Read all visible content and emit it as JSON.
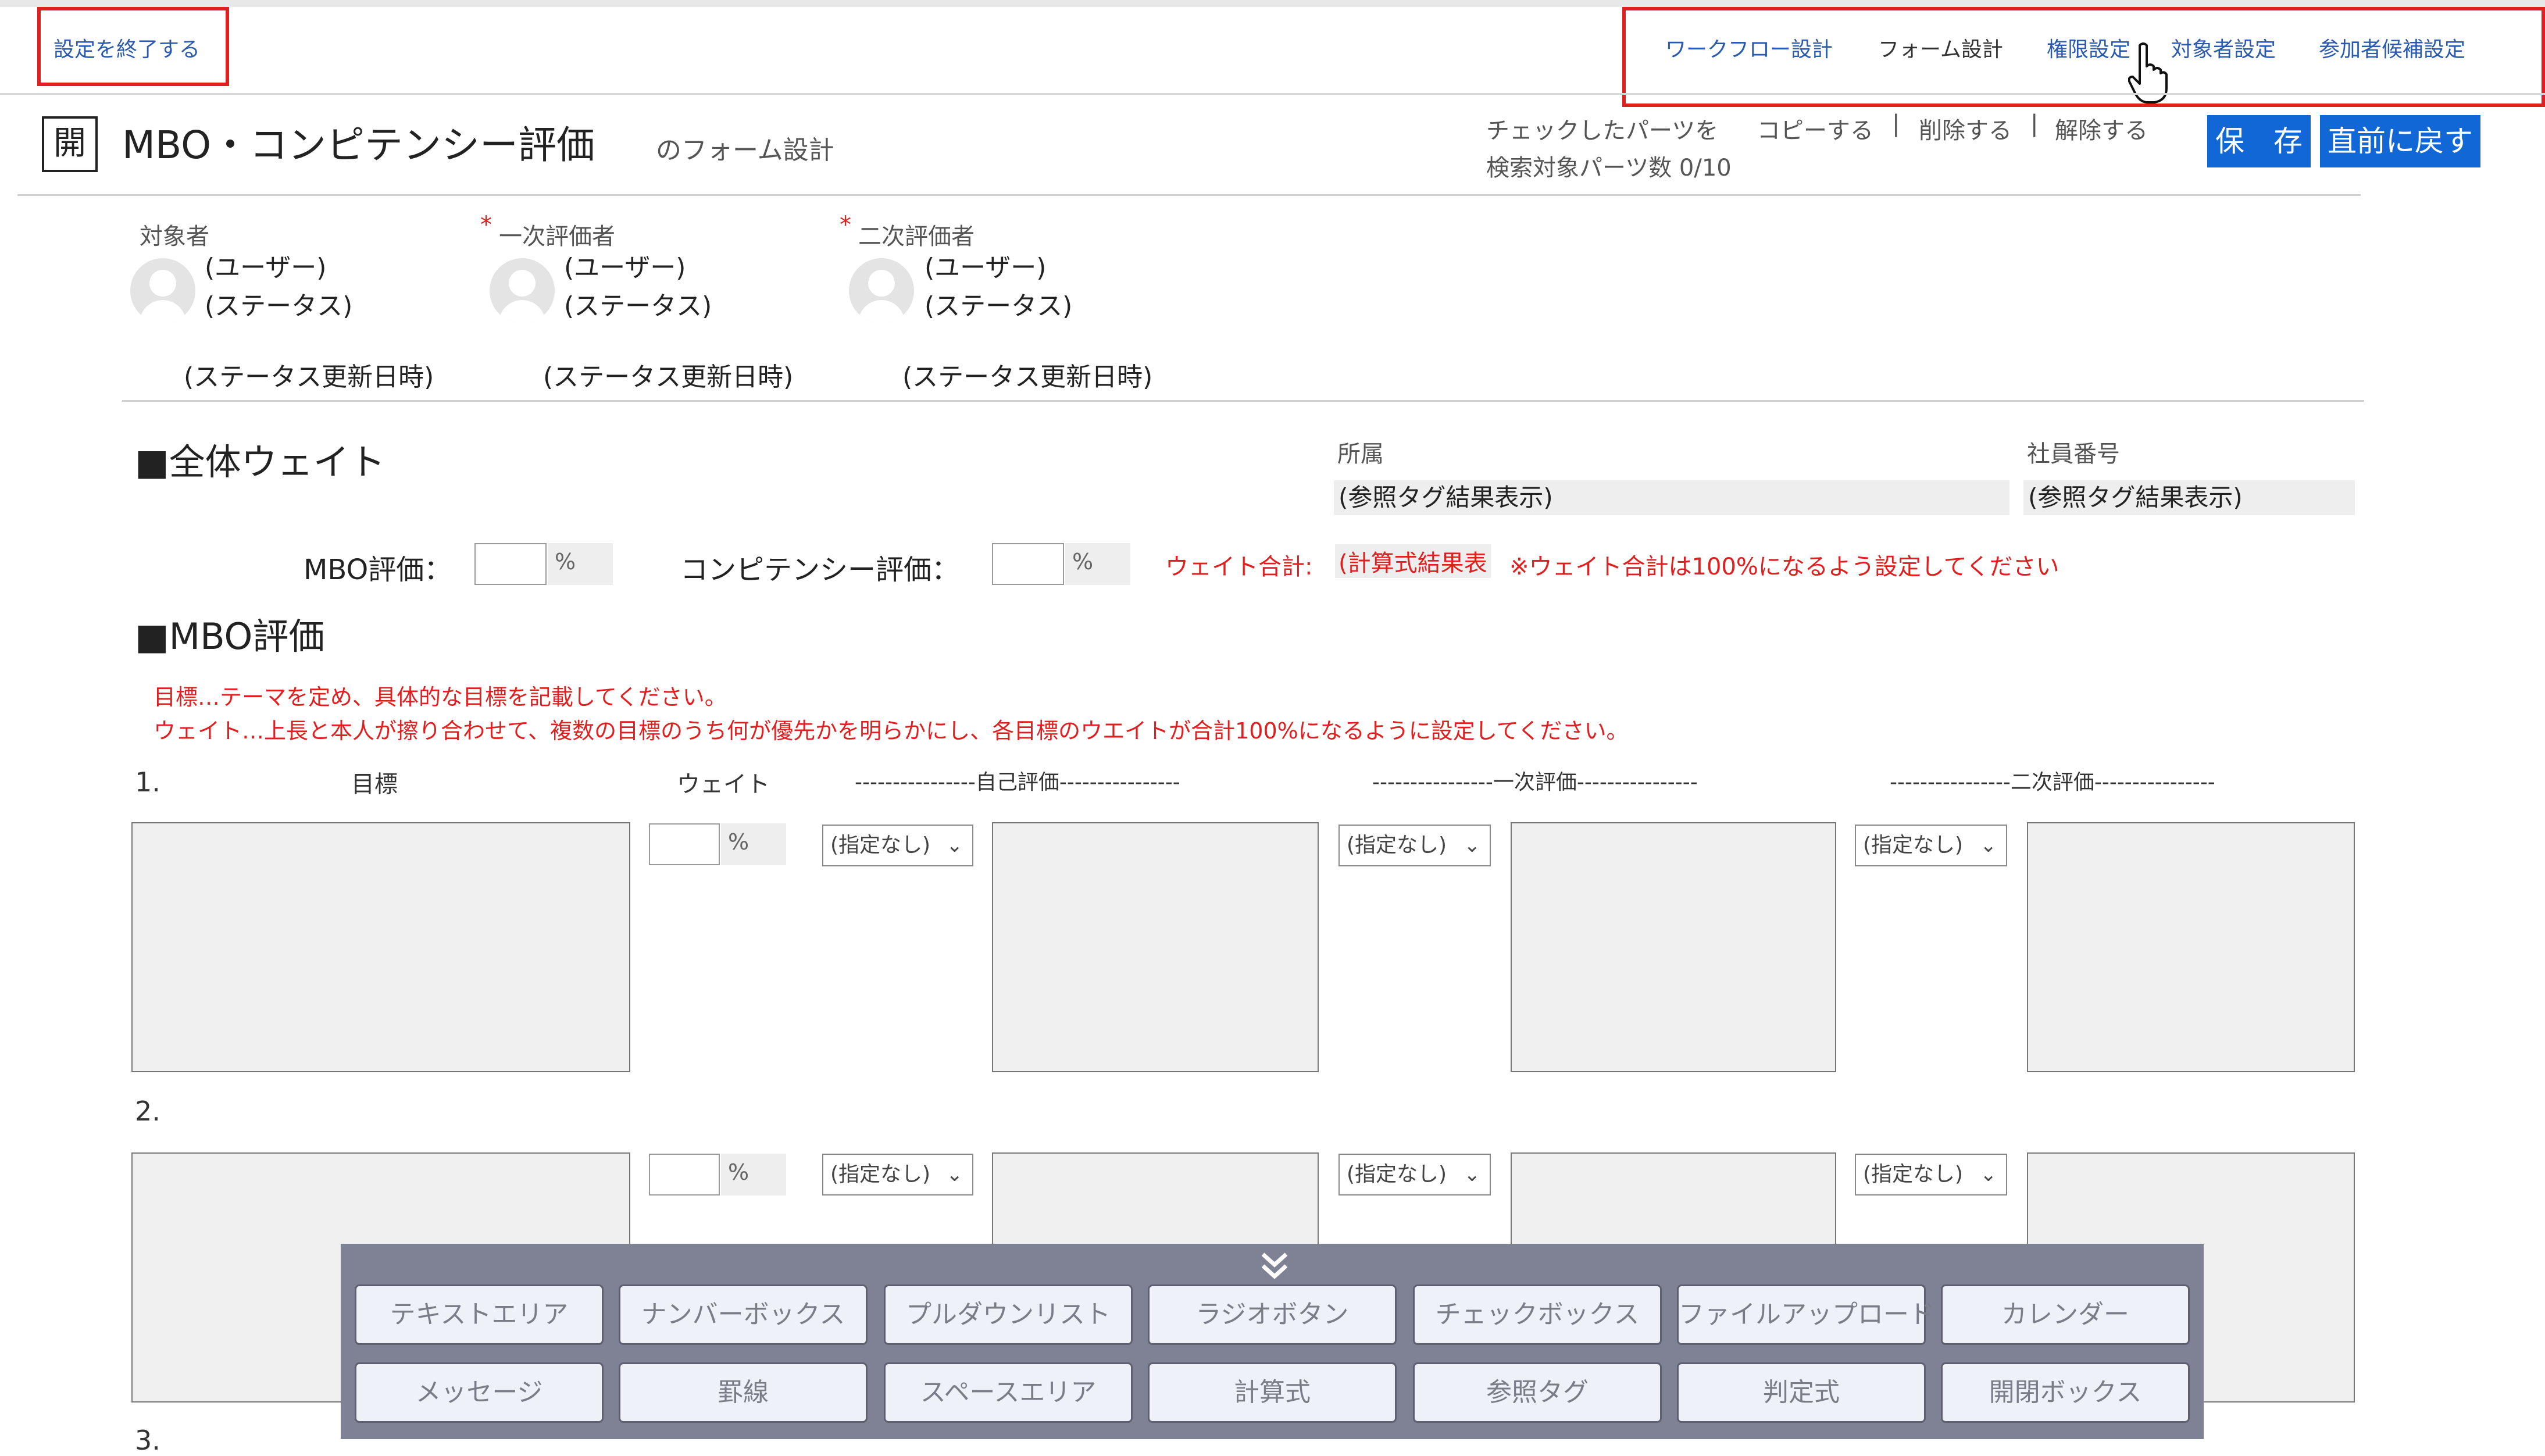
{
  "header": {
    "exit_link": "設定を終了する",
    "nav": [
      "ワークフロー設計",
      "フォーム設計",
      "権限設定",
      "対象者設定",
      "参加者候補設定"
    ],
    "title_icon": "開",
    "title": "MBO・コンピテンシー評価",
    "subtitle": "のフォーム設計",
    "checked_parts_label": "チェックしたパーツを",
    "actions": [
      "コピーする",
      "削除する",
      "解除する"
    ],
    "action_separator": "|",
    "search_count": "検索対象パーツ数 0/10",
    "save_button": "保　存",
    "revert_button": "直前に戻す"
  },
  "participants": [
    {
      "label": "対象者",
      "required": false,
      "user": "(ユーザー)",
      "status": "(ステータス)",
      "updated": "(ステータス更新日時)"
    },
    {
      "label": "一次評価者",
      "required": true,
      "user": "(ユーザー)",
      "status": "(ステータス)",
      "updated": "(ステータス更新日時)"
    },
    {
      "label": "二次評価者",
      "required": true,
      "user": "(ユーザー)",
      "status": "(ステータス)",
      "updated": "(ステータス更新日時)"
    }
  ],
  "required_mark": "*",
  "weight_section": {
    "heading": "■全体ウェイト",
    "affiliation_label": "所属",
    "affiliation_value": "(参照タグ結果表示)",
    "employee_no_label": "社員番号",
    "employee_no_value": "(参照タグ結果表示)",
    "mbo_label": "MBO評価：",
    "competency_label": "コンピテンシー評価：",
    "percent": "%",
    "total_label": "ウェイト合計:",
    "total_value": "(計算式結果表",
    "total_note": "※ウェイト合計は100%になるよう設定してください"
  },
  "mbo_section": {
    "heading": "■MBO評価",
    "instruction_1": "目標…テーマを定め、具体的な目標を記載してください。",
    "instruction_2": "ウェイト…上長と本人が擦り合わせて、複数の目標のうち何が優先かを明らかにし、各目標のウエイトが合計100%になるように設定してください。",
    "columns": {
      "goal": "目標",
      "weight": "ウェイト",
      "self": "----------------自己評価----------------",
      "first": "----------------一次評価----------------",
      "second": "----------------二次評価----------------"
    },
    "rows": [
      "1.",
      "2.",
      "3."
    ],
    "select_default": "(指定なし)",
    "percent": "%"
  },
  "palette": {
    "collapse_icon": "chevron-double-down",
    "row1": [
      "テキストエリア",
      "ナンバーボックス",
      "プルダウンリスト",
      "ラジオボタン",
      "チェックボックス",
      "ファイルアップロード",
      "カレンダー"
    ],
    "row2": [
      "メッセージ",
      "罫線",
      "スペースエリア",
      "計算式",
      "参照タグ",
      "判定式",
      "開閉ボックス"
    ]
  },
  "colors": {
    "accent": "#1267d6",
    "highlight_red": "#e02020",
    "link_blue": "#2a5ab0",
    "palette_bg": "#7e8294"
  }
}
